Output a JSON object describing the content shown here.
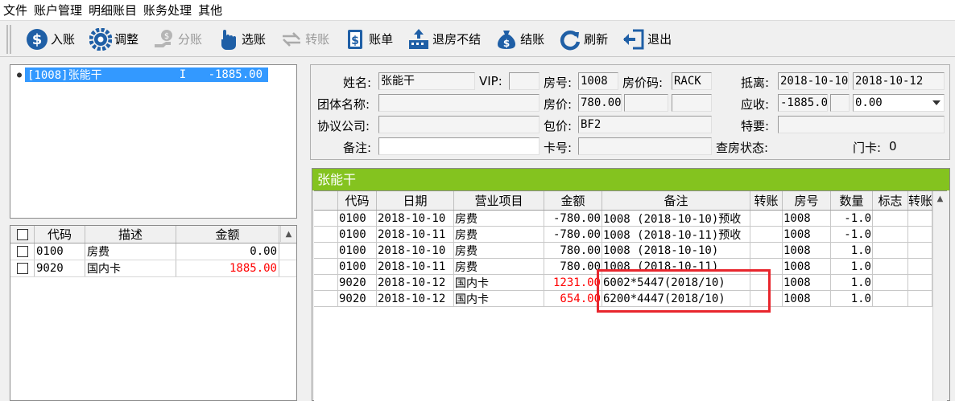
{
  "menu": [
    "文件",
    "账户管理",
    "明细账目",
    "账务处理",
    "其他"
  ],
  "toolbar": [
    {
      "label": "入账",
      "icon": "dollar-coin-icon",
      "disabled": false
    },
    {
      "label": "调整",
      "icon": "gear-icon",
      "disabled": false
    },
    {
      "label": "分账",
      "icon": "hand-money-icon",
      "disabled": true
    },
    {
      "label": "选账",
      "icon": "hand-pointer-icon",
      "disabled": false
    },
    {
      "label": "转账",
      "icon": "transfer-arrows-icon",
      "disabled": true
    },
    {
      "label": "账单",
      "icon": "bill-icon",
      "disabled": false
    },
    {
      "label": "退房不结",
      "icon": "building-up-icon",
      "disabled": false
    },
    {
      "label": "结账",
      "icon": "money-bag-icon",
      "disabled": false
    },
    {
      "label": "刷新",
      "icon": "refresh-icon",
      "disabled": false
    },
    {
      "label": "退出",
      "icon": "exit-icon",
      "disabled": false
    }
  ],
  "guest_list": [
    {
      "room": "[1008]张能干",
      "flag": "I",
      "balance": "-1885.00"
    }
  ],
  "summary_table": {
    "headers": [
      "代码",
      "描述",
      "金额"
    ],
    "rows": [
      {
        "code": "0100",
        "desc": "房费",
        "amount": "0.00",
        "red": false
      },
      {
        "code": "9020",
        "desc": "国内卡",
        "amount": "1885.00",
        "red": true
      }
    ]
  },
  "form": {
    "name_label": "姓名:",
    "name_value": "张能干",
    "vip_label": "VIP:",
    "vip_value": "",
    "room_label": "房号:",
    "room_value": "1008",
    "rate_code_label": "房价码:",
    "rate_code_value": "RACK",
    "arrive_leave_label": "抵离:",
    "arrive_value": "2018-10-10",
    "leave_value": "2018-10-12",
    "group_label": "团体名称:",
    "group_value": "",
    "price_label": "房价:",
    "price_value": "780.00",
    "receivable_label": "应收:",
    "receivable_value": "-1885.0",
    "receivable_select": "0.00",
    "company_label": "协议公司:",
    "company_value": "",
    "package_label": "包价:",
    "package_value": "BF2",
    "special_label": "特要:",
    "special_value": "",
    "remark_label": "备注:",
    "remark_value": "",
    "card_label": "卡号:",
    "card_value": "",
    "checkroom_label": "查房状态:",
    "doorcard_label": "门卡:",
    "doorcard_value": "0"
  },
  "grid": {
    "title": "张能干",
    "headers": [
      "",
      "代码",
      "日期",
      "营业项目",
      "金额",
      "备注",
      "转账",
      "房号",
      "数量",
      "标志",
      "转账"
    ],
    "rows": [
      {
        "code": "0100",
        "date": "2018-10-10",
        "item": "房费",
        "amount": "-780.00",
        "note": "1008 (2018-10-10)预收",
        "room": "1008",
        "qty": "-1.0",
        "red": false
      },
      {
        "code": "0100",
        "date": "2018-10-11",
        "item": "房费",
        "amount": "-780.00",
        "note": "1008 (2018-10-11)预收",
        "room": "1008",
        "qty": "-1.0",
        "red": false
      },
      {
        "code": "0100",
        "date": "2018-10-10",
        "item": "房费",
        "amount": "780.00",
        "note": "1008 (2018-10-10)",
        "room": "1008",
        "qty": "1.0",
        "red": false
      },
      {
        "code": "0100",
        "date": "2018-10-11",
        "item": "房费",
        "amount": "780.00",
        "note": "1008 (2018-10-11)",
        "room": "1008",
        "qty": "1.0",
        "red": false
      },
      {
        "code": "9020",
        "date": "2018-10-12",
        "item": "国内卡",
        "amount": "1231.00",
        "note": "6002*5447(2018/10)",
        "room": "1008",
        "qty": "1.0",
        "red": true
      },
      {
        "code": "9020",
        "date": "2018-10-12",
        "item": "国内卡",
        "amount": "654.00",
        "note": "6200*4447(2018/10)",
        "room": "1008",
        "qty": "1.0",
        "red": true
      }
    ]
  }
}
